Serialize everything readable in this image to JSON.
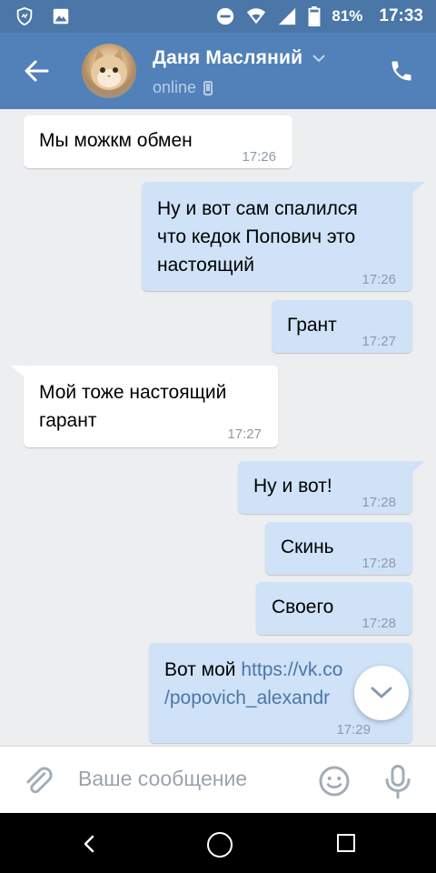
{
  "status_bar": {
    "battery": "81%",
    "time": "17:33"
  },
  "header": {
    "contact_name": "Даня Масляний",
    "status": "online"
  },
  "messages": [
    {
      "direction": "in",
      "text": "Мы можкм обмен",
      "time": "17:26"
    },
    {
      "direction": "out",
      "lines": [
        "Ну и вот сам спалился",
        "что кедок Попович это",
        "настоящий"
      ],
      "time": "17:26"
    },
    {
      "direction": "out",
      "text": "Грант",
      "time": "17:27"
    },
    {
      "direction": "in",
      "lines": [
        "Мой тоже настоящий",
        "гарант"
      ],
      "time": "17:27"
    },
    {
      "direction": "out",
      "text": "Ну и вот!",
      "time": "17:28"
    },
    {
      "direction": "out",
      "text": "Скинь",
      "time": "17:28"
    },
    {
      "direction": "out",
      "text": "Своего",
      "time": "17:28"
    },
    {
      "direction": "out",
      "prefix": "Вот мой ",
      "link_part1": "https://vk.co",
      "link_part2": "/popovich_alexandr",
      "time": "17:29"
    }
  ],
  "composer": {
    "placeholder": "Ваше сообщение"
  }
}
